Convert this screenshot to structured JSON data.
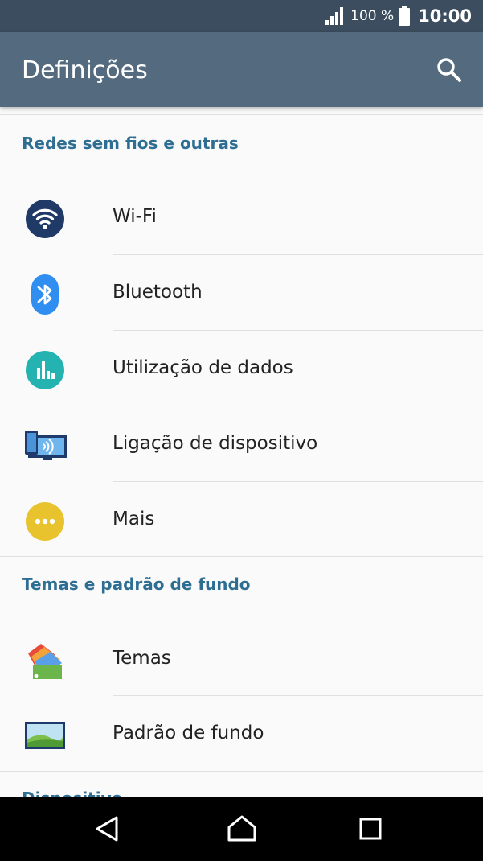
{
  "status": {
    "battery": "100 %",
    "time": "10:00"
  },
  "appbar": {
    "title": "Definições",
    "search_icon": "search-icon"
  },
  "sections": [
    {
      "header": "Redes sem fios e outras",
      "items": [
        {
          "label": "Wi-Fi",
          "icon": "wifi-icon"
        },
        {
          "label": "Bluetooth",
          "icon": "bluetooth-icon"
        },
        {
          "label": "Utilização de dados",
          "icon": "data-usage-icon"
        },
        {
          "label": "Ligação de dispositivo",
          "icon": "device-connection-icon"
        },
        {
          "label": "Mais",
          "icon": "more-icon"
        }
      ]
    },
    {
      "header": "Temas e padrão de fundo",
      "items": [
        {
          "label": "Temas",
          "icon": "themes-icon"
        },
        {
          "label": "Padrão de fundo",
          "icon": "wallpaper-icon"
        }
      ]
    },
    {
      "header": "Dispositivo",
      "items": []
    }
  ],
  "navbar": {
    "back_icon": "back-icon",
    "home_icon": "home-icon",
    "recents_icon": "recents-icon"
  },
  "colors": {
    "status_bar": "#3b4d5e",
    "app_bar": "#546a7f",
    "section_header": "#2f6e93",
    "background": "#fafafa"
  }
}
